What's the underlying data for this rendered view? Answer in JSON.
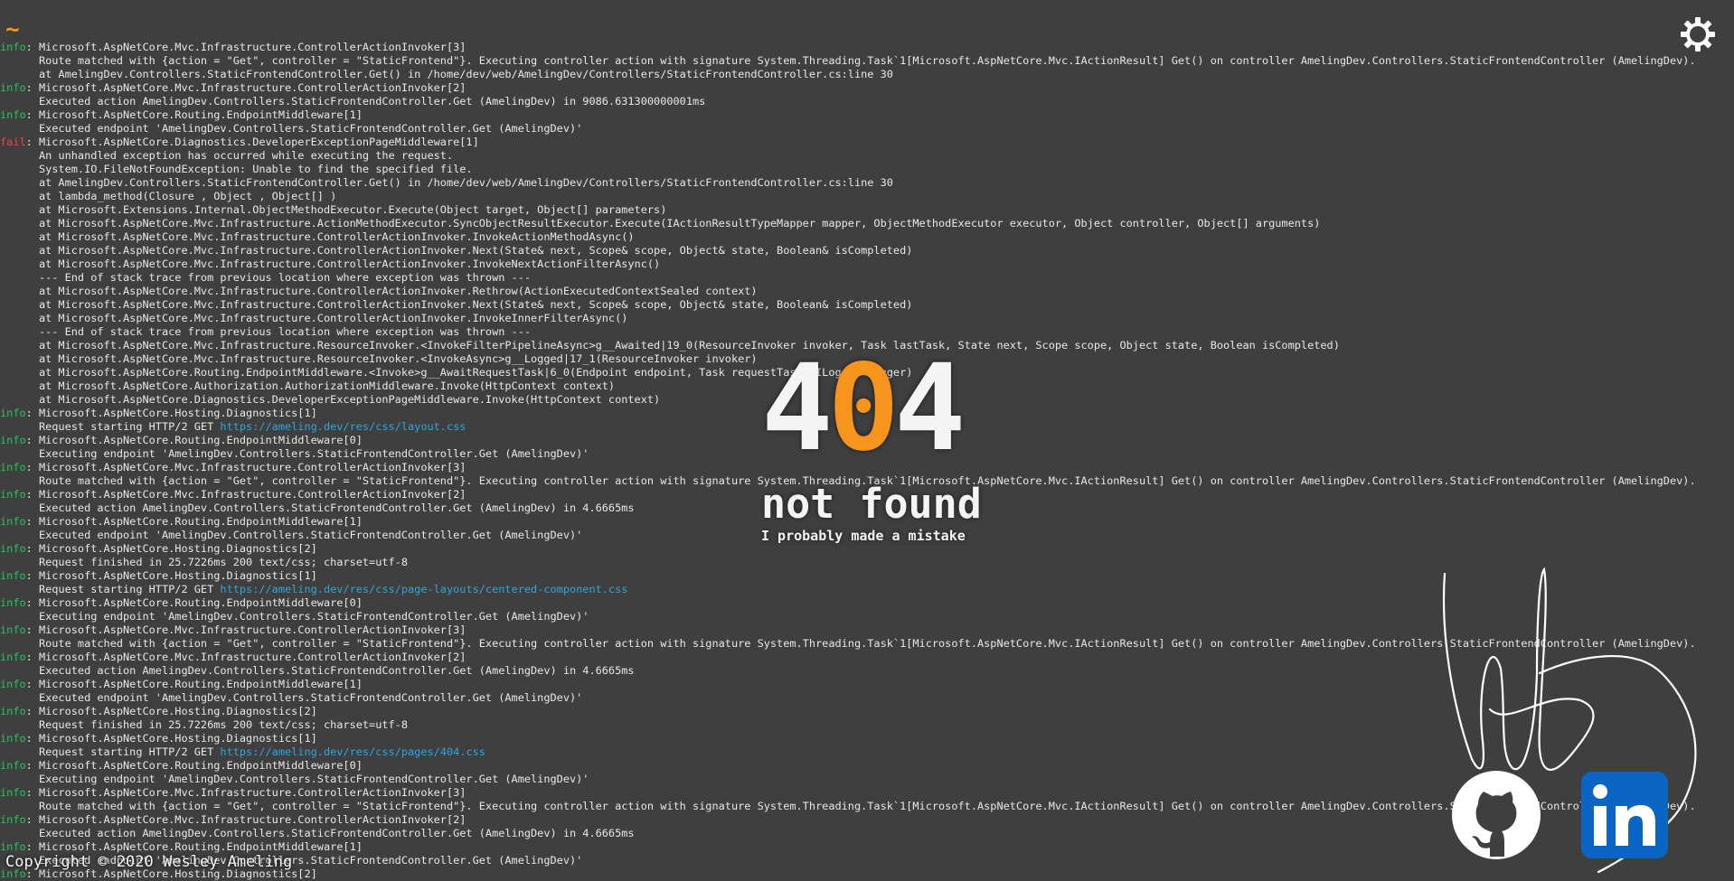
{
  "prompt_symbol": "~",
  "log_lines": [
    {
      "lvl": "info",
      "text": ": Microsoft.AspNetCore.Mvc.Infrastructure.ControllerActionInvoker[3]"
    },
    {
      "lvl": "",
      "text": "      Route matched with {action = \"Get\", controller = \"StaticFrontend\"}. Executing controller action with signature System.Threading.Task`1[Microsoft.AspNetCore.Mvc.IActionResult] Get() on controller AmelingDev.Controllers.StaticFrontendController (AmelingDev)."
    },
    {
      "lvl": "",
      "text": "      at AmelingDev.Controllers.StaticFrontendController.Get() in /home/dev/web/AmelingDev/Controllers/StaticFrontendController.cs:line 30"
    },
    {
      "lvl": "info",
      "text": ": Microsoft.AspNetCore.Mvc.Infrastructure.ControllerActionInvoker[2]"
    },
    {
      "lvl": "",
      "text": "      Executed action AmelingDev.Controllers.StaticFrontendController.Get (AmelingDev) in 9086.631300000001ms"
    },
    {
      "lvl": "info",
      "text": ": Microsoft.AspNetCore.Routing.EndpointMiddleware[1]"
    },
    {
      "lvl": "",
      "text": "      Executed endpoint 'AmelingDev.Controllers.StaticFrontendController.Get (AmelingDev)'"
    },
    {
      "lvl": "fail",
      "text": ": Microsoft.AspNetCore.Diagnostics.DeveloperExceptionPageMiddleware[1]"
    },
    {
      "lvl": "",
      "text": "      An unhandled exception has occurred while executing the request."
    },
    {
      "lvl": "",
      "text": "      System.IO.FileNotFoundException: Unable to find the specified file."
    },
    {
      "lvl": "",
      "text": "      at AmelingDev.Controllers.StaticFrontendController.Get() in /home/dev/web/AmelingDev/Controllers/StaticFrontendController.cs:line 30"
    },
    {
      "lvl": "",
      "text": "      at lambda_method(Closure , Object , Object[] )"
    },
    {
      "lvl": "",
      "text": "      at Microsoft.Extensions.Internal.ObjectMethodExecutor.Execute(Object target, Object[] parameters)"
    },
    {
      "lvl": "",
      "text": "      at Microsoft.AspNetCore.Mvc.Infrastructure.ActionMethodExecutor.SyncObjectResultExecutor.Execute(IActionResultTypeMapper mapper, ObjectMethodExecutor executor, Object controller, Object[] arguments)"
    },
    {
      "lvl": "",
      "text": "      at Microsoft.AspNetCore.Mvc.Infrastructure.ControllerActionInvoker.InvokeActionMethodAsync()"
    },
    {
      "lvl": "",
      "text": "      at Microsoft.AspNetCore.Mvc.Infrastructure.ControllerActionInvoker.Next(State& next, Scope& scope, Object& state, Boolean& isCompleted)"
    },
    {
      "lvl": "",
      "text": "      at Microsoft.AspNetCore.Mvc.Infrastructure.ControllerActionInvoker.InvokeNextActionFilterAsync()"
    },
    {
      "lvl": "",
      "text": "      --- End of stack trace from previous location where exception was thrown ---"
    },
    {
      "lvl": "",
      "text": "      at Microsoft.AspNetCore.Mvc.Infrastructure.ControllerActionInvoker.Rethrow(ActionExecutedContextSealed context)"
    },
    {
      "lvl": "",
      "text": "      at Microsoft.AspNetCore.Mvc.Infrastructure.ControllerActionInvoker.Next(State& next, Scope& scope, Object& state, Boolean& isCompleted)"
    },
    {
      "lvl": "",
      "text": "      at Microsoft.AspNetCore.Mvc.Infrastructure.ControllerActionInvoker.InvokeInnerFilterAsync()"
    },
    {
      "lvl": "",
      "text": "      --- End of stack trace from previous location where exception was thrown ---"
    },
    {
      "lvl": "",
      "text": "      at Microsoft.AspNetCore.Mvc.Infrastructure.ResourceInvoker.<InvokeFilterPipelineAsync>g__Awaited|19_0(ResourceInvoker invoker, Task lastTask, State next, Scope scope, Object state, Boolean isCompleted)"
    },
    {
      "lvl": "",
      "text": "      at Microsoft.AspNetCore.Mvc.Infrastructure.ResourceInvoker.<InvokeAsync>g__Logged|17_1(ResourceInvoker invoker)"
    },
    {
      "lvl": "",
      "text": "      at Microsoft.AspNetCore.Routing.EndpointMiddleware.<Invoke>g__AwaitRequestTask|6_0(Endpoint endpoint, Task requestTask, ILogger logger)"
    },
    {
      "lvl": "",
      "text": "      at Microsoft.AspNetCore.Authorization.AuthorizationMiddleware.Invoke(HttpContext context)"
    },
    {
      "lvl": "",
      "text": "      at Microsoft.AspNetCore.Diagnostics.DeveloperExceptionPageMiddleware.Invoke(HttpContext context)"
    },
    {
      "lvl": "info",
      "text": ": Microsoft.AspNetCore.Hosting.Diagnostics[1]"
    },
    {
      "lvl": "",
      "text": "      Request starting HTTP/2 GET ",
      "url": "https://ameling.dev/res/css/layout.css"
    },
    {
      "lvl": "info",
      "text": ": Microsoft.AspNetCore.Routing.EndpointMiddleware[0]"
    },
    {
      "lvl": "",
      "text": "      Executing endpoint 'AmelingDev.Controllers.StaticFrontendController.Get (AmelingDev)'"
    },
    {
      "lvl": "info",
      "text": ": Microsoft.AspNetCore.Mvc.Infrastructure.ControllerActionInvoker[3]"
    },
    {
      "lvl": "",
      "text": "      Route matched with {action = \"Get\", controller = \"StaticFrontend\"}. Executing controller action with signature System.Threading.Task`1[Microsoft.AspNetCore.Mvc.IActionResult] Get() on controller AmelingDev.Controllers.StaticFrontendController (AmelingDev)."
    },
    {
      "lvl": "info",
      "text": ": Microsoft.AspNetCore.Mvc.Infrastructure.ControllerActionInvoker[2]"
    },
    {
      "lvl": "",
      "text": "      Executed action AmelingDev.Controllers.StaticFrontendController.Get (AmelingDev) in 4.6665ms"
    },
    {
      "lvl": "info",
      "text": ": Microsoft.AspNetCore.Routing.EndpointMiddleware[1]"
    },
    {
      "lvl": "",
      "text": "      Executed endpoint 'AmelingDev.Controllers.StaticFrontendController.Get (AmelingDev)'"
    },
    {
      "lvl": "info",
      "text": ": Microsoft.AspNetCore.Hosting.Diagnostics[2]"
    },
    {
      "lvl": "",
      "text": "      Request finished in 25.7226ms 200 text/css; charset=utf-8"
    },
    {
      "lvl": "info",
      "text": ": Microsoft.AspNetCore.Hosting.Diagnostics[1]"
    },
    {
      "lvl": "",
      "text": "      Request starting HTTP/2 GET ",
      "url": "https://ameling.dev/res/css/page-layouts/centered-component.css"
    },
    {
      "lvl": "info",
      "text": ": Microsoft.AspNetCore.Routing.EndpointMiddleware[0]"
    },
    {
      "lvl": "",
      "text": "      Executing endpoint 'AmelingDev.Controllers.StaticFrontendController.Get (AmelingDev)'"
    },
    {
      "lvl": "info",
      "text": ": Microsoft.AspNetCore.Mvc.Infrastructure.ControllerActionInvoker[3]"
    },
    {
      "lvl": "",
      "text": "      Route matched with {action = \"Get\", controller = \"StaticFrontend\"}. Executing controller action with signature System.Threading.Task`1[Microsoft.AspNetCore.Mvc.IActionResult] Get() on controller AmelingDev.Controllers.StaticFrontendController (AmelingDev)."
    },
    {
      "lvl": "info",
      "text": ": Microsoft.AspNetCore.Mvc.Infrastructure.ControllerActionInvoker[2]"
    },
    {
      "lvl": "",
      "text": "      Executed action AmelingDev.Controllers.StaticFrontendController.Get (AmelingDev) in 4.6665ms"
    },
    {
      "lvl": "info",
      "text": ": Microsoft.AspNetCore.Routing.EndpointMiddleware[1]"
    },
    {
      "lvl": "",
      "text": "      Executed endpoint 'AmelingDev.Controllers.StaticFrontendController.Get (AmelingDev)'"
    },
    {
      "lvl": "info",
      "text": ": Microsoft.AspNetCore.Hosting.Diagnostics[2]"
    },
    {
      "lvl": "",
      "text": "      Request finished in 25.7226ms 200 text/css; charset=utf-8"
    },
    {
      "lvl": "info",
      "text": ": Microsoft.AspNetCore.Hosting.Diagnostics[1]"
    },
    {
      "lvl": "",
      "text": "      Request starting HTTP/2 GET ",
      "url": "https://ameling.dev/res/css/pages/404.css"
    },
    {
      "lvl": "info",
      "text": ": Microsoft.AspNetCore.Routing.EndpointMiddleware[0]"
    },
    {
      "lvl": "",
      "text": "      Executing endpoint 'AmelingDev.Controllers.StaticFrontendController.Get (AmelingDev)'"
    },
    {
      "lvl": "info",
      "text": ": Microsoft.AspNetCore.Mvc.Infrastructure.ControllerActionInvoker[3]"
    },
    {
      "lvl": "",
      "text": "      Route matched with {action = \"Get\", controller = \"StaticFrontend\"}. Executing controller action with signature System.Threading.Task`1[Microsoft.AspNetCore.Mvc.IActionResult] Get() on controller AmelingDev.Controllers.StaticFrontendController (AmelingDev)."
    },
    {
      "lvl": "info",
      "text": ": Microsoft.AspNetCore.Mvc.Infrastructure.ControllerActionInvoker[2]"
    },
    {
      "lvl": "",
      "text": "      Executed action AmelingDev.Controllers.StaticFrontendController.Get (AmelingDev) in 4.6665ms"
    },
    {
      "lvl": "info",
      "text": ": Microsoft.AspNetCore.Routing.EndpointMiddleware[1]"
    },
    {
      "lvl": "",
      "text": "      Executed endpoint 'AmelingDev.Controllers.StaticFrontendController.Get (AmelingDev)'"
    },
    {
      "lvl": "info",
      "text": ": Microsoft.AspNetCore.Hosting.Diagnostics[2]"
    }
  ],
  "level_labels": {
    "info": "info",
    "fail": "fail"
  },
  "error": {
    "code_digits": [
      "4",
      "0",
      "4"
    ],
    "title": "not found",
    "subtitle": "I probably made a mistake"
  },
  "footer": {
    "copyright": "Copyright © 2020 Wesley Ameling"
  },
  "icons": {
    "theme_toggle": "gear-icon",
    "github": "github-icon",
    "linkedin": "linkedin-icon"
  },
  "colors": {
    "background": "#3f3f3f",
    "accent": "#f7941d",
    "info": "#22c55e",
    "fail": "#ef4444",
    "link": "#2aa8e0",
    "linkedin": "#0a66c2"
  }
}
